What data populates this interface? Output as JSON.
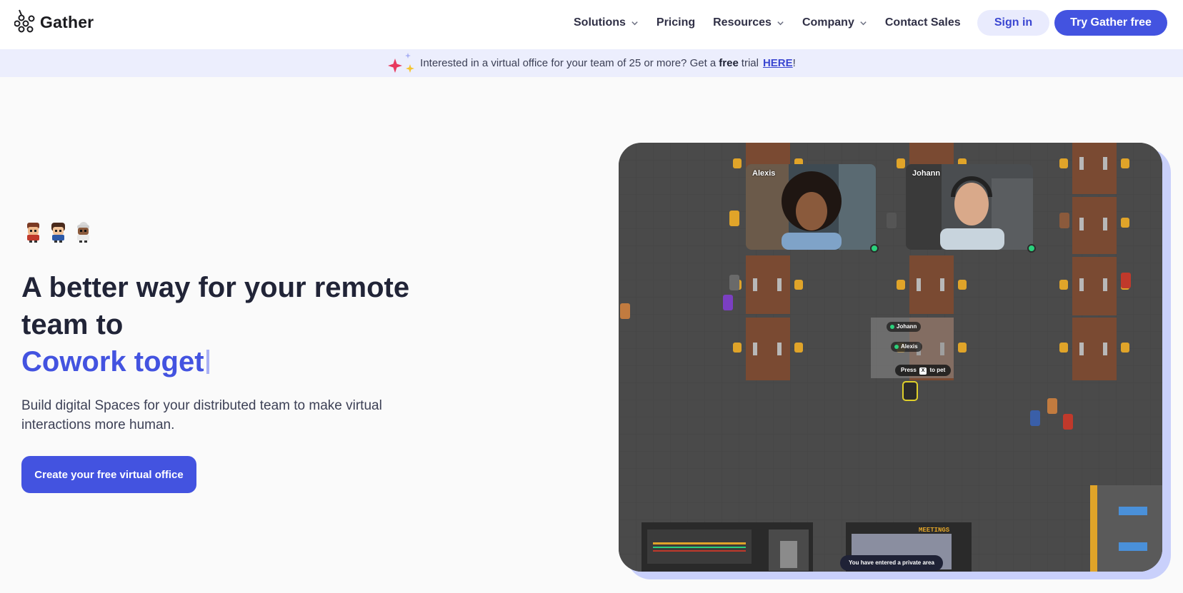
{
  "brand": {
    "name": "Gather",
    "logo_icon": "gather-logo-icon"
  },
  "nav": {
    "items": [
      {
        "label": "Solutions",
        "has_dropdown": true
      },
      {
        "label": "Pricing",
        "has_dropdown": false
      },
      {
        "label": "Resources",
        "has_dropdown": true
      },
      {
        "label": "Company",
        "has_dropdown": true
      },
      {
        "label": "Contact Sales",
        "has_dropdown": false
      }
    ],
    "sign_in": "Sign in",
    "try_free": "Try Gather free"
  },
  "banner": {
    "text_before": "Interested in a virtual office for your team of 25 or more? Get a",
    "bold": "free",
    "text_after": "trial",
    "link": "HERE",
    "suffix": "!"
  },
  "hero": {
    "headline": "A better way for your remote team to",
    "headline_accent": "Cowork toget",
    "subtitle": "Build digital Spaces for your distributed team to make virtual interactions more human.",
    "cta": "Create your free virtual office"
  },
  "scene": {
    "video_tiles": [
      {
        "name": "Alexis"
      },
      {
        "name": "Johann"
      }
    ],
    "proximity_tags": [
      "Johann",
      "Alexis"
    ],
    "press_hint": {
      "before": "Press",
      "key": "X",
      "after": "to pet"
    },
    "sign_text": "MEETINGS",
    "toast": "You have entered a private area"
  },
  "colors": {
    "primary": "#4353e0",
    "banner_bg": "#eceefd",
    "signin_bg": "#e9ebfd",
    "floor": "#4a4a4a",
    "desk": "#7a4a32",
    "online": "#2ad17c"
  }
}
